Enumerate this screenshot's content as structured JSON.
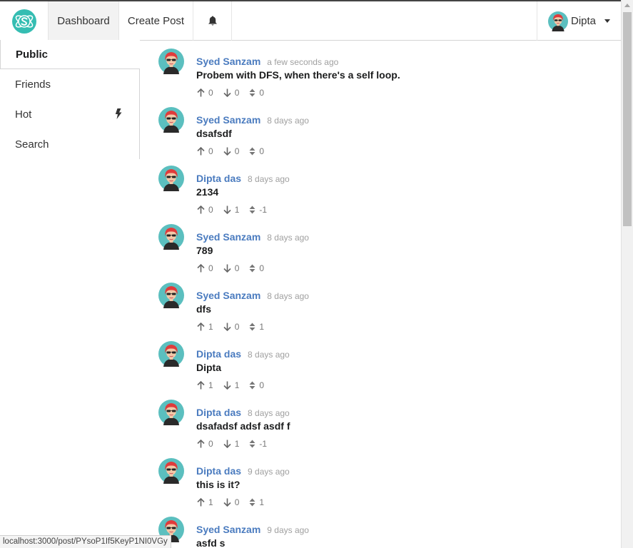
{
  "header": {
    "logo_icon": "semantic-react-logo-icon",
    "nav": {
      "dashboard": "Dashboard",
      "create_post": "Create Post",
      "notifications_icon": "bell-icon"
    },
    "user": {
      "name": "Dipta",
      "menu_icon": "caret-down-icon"
    }
  },
  "sidebar": {
    "items": [
      {
        "label": "Public",
        "active": true
      },
      {
        "label": "Friends"
      },
      {
        "label": "Hot",
        "icon": "bolt-icon"
      },
      {
        "label": "Search"
      }
    ]
  },
  "posts": [
    {
      "author": "Syed Sanzam",
      "time": "a few seconds ago",
      "text": "Probem with DFS, when there's a self loop.",
      "up": "0",
      "down": "0",
      "score": "0"
    },
    {
      "author": "Syed Sanzam",
      "time": "8 days ago",
      "text": "dsafsdf",
      "up": "0",
      "down": "0",
      "score": "0"
    },
    {
      "author": "Dipta das",
      "time": "8 days ago",
      "text": "2134",
      "up": "0",
      "down": "1",
      "score": "-1"
    },
    {
      "author": "Syed Sanzam",
      "time": "8 days ago",
      "text": "789",
      "up": "0",
      "down": "0",
      "score": "0"
    },
    {
      "author": "Syed Sanzam",
      "time": "8 days ago",
      "text": "dfs",
      "up": "1",
      "down": "0",
      "score": "1"
    },
    {
      "author": "Dipta das",
      "time": "8 days ago",
      "text": "Dipta",
      "up": "1",
      "down": "1",
      "score": "0"
    },
    {
      "author": "Dipta das",
      "time": "8 days ago",
      "text": "dsafadsf adsf asdf f",
      "up": "0",
      "down": "1",
      "score": "-1"
    },
    {
      "author": "Dipta das",
      "time": "9 days ago",
      "text": "this is it?",
      "up": "1",
      "down": "0",
      "score": "1"
    },
    {
      "author": "Syed Sanzam",
      "time": "9 days ago",
      "text": "asfd s",
      "up": "",
      "down": "",
      "score": ""
    }
  ],
  "status_bar": {
    "url": "localhost:3000/post/PYsoP1If5KeyP1NI0VGy"
  },
  "colors": {
    "author_link": "#4a7bbf",
    "logo": "#35bdb2",
    "avatar_bg": "#5bbfbf",
    "avatar_hair": "#e03b3b"
  }
}
